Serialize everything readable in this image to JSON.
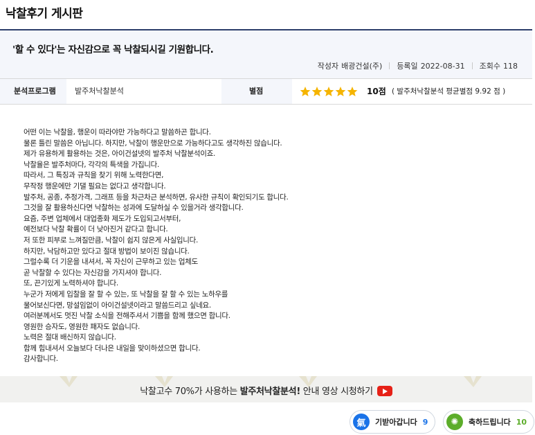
{
  "board": {
    "title": "낙찰후기 게시판"
  },
  "post": {
    "title": "'할 수 있다'는 자신감으로 꼭 낙찰되시길 기원합니다.",
    "author_label": "작성자",
    "author": "배광건설(주)",
    "date_label": "등록일",
    "date": "2022-08-31",
    "views_label": "조회수",
    "views": "118"
  },
  "info": {
    "program_label": "분석프로그램",
    "program": "발주처낙찰분석",
    "rating_label": "별점",
    "stars": 5,
    "score": "10점",
    "avg_text": "( 발주처낙찰분석 평균별점 9.92 점 )",
    "star_color": "#f5b400"
  },
  "content": {
    "lines": [
      "어떤 이는 낙찰을, 행운이 따라야만 가능하다고 말씀하곤 합니다.",
      "물론 틀린 말씀은 아닙니다. 하지만, 낙찰이 행운만으로 가능하다고도 생각하진 않습니다.",
      "제가 유용하게 활용하는 것은, 아이건설넷의 발주처 낙찰분석이죠.",
      "낙찰율은 발주처마다, 각각의 특색을 가집니다.",
      "따라서, 그 특징과 규칙을 찾기 위해 노력한다면,",
      "무작정 행운에만 기댈 필요는 없다고 생각합니다.",
      "발주처, 공종, 추정가격, 그래프 등을 차근차근 분석하면, 유사한 규칙이 확인되기도 합니다.",
      "그것을 잘 활용하신다면 낙찰하는 성과에 도달하실 수 있을거라 생각합니다.",
      "요즘, 주변 업체에서 대업종화 제도가 도입되고서부터,",
      "예전보다 낙찰 확률이 더 낮아진거 같다고 합니다.",
      "저 또한 피부로 느껴질만큼, 낙찰이 쉽지 않은게 사실입니다.",
      "하지만, 낙담하고만 있다고 절대 방법이 보이진 않습니다.",
      "그럴수록 더 기운을 내셔서, 꼭 자신이 근무하고 있는 업체도",
      "곧 낙찰할 수 있다는 자신감을 가지셔야 합니다.",
      "또, 끈기있게 노력하셔야 합니다.",
      "누군가 저에게 입찰을 잘 할 수 있는, 또 낙찰을 잘 할 수 있는 노하우를",
      "물어보신다면, 망설임없이 아이건설넷이라고 말씀드리고 싶네요.",
      "여러분께서도 멋진 낙찰 소식을 전해주셔서 기쁨을 함께 했으면 합니다.",
      "영원한 승자도, 영원한 패자도 없습니다.",
      "노력은 절대 배신하지 않습니다.",
      "함께 힘내셔서 오늘보다 더나은 내일을 맞이하셨으면 합니다.",
      "감사합니다."
    ]
  },
  "banner": {
    "text_pre": "낙찰고수 70%가 사용하는 ",
    "text_bold": "발주처낙찰분석!",
    "text_post": " 안내 영상 시청하기",
    "icon": "youtube-play-icon"
  },
  "reactions": [
    {
      "icon_glyph": "氣",
      "icon_name": "energy-icon",
      "label": "기받아갑니다",
      "count": "9",
      "icon_color": "#1a73e8",
      "count_color": "#1a73e8"
    },
    {
      "icon_glyph": "✺",
      "icon_name": "congrats-icon",
      "label": "축하드립니다",
      "count": "10",
      "icon_color": "#5cad2a",
      "count_color": "#5cad2a"
    }
  ]
}
